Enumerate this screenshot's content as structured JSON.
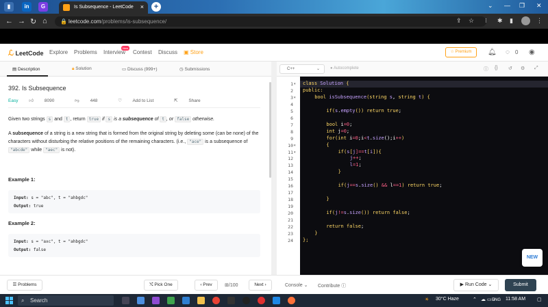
{
  "browser": {
    "tab_title": "Is Subsequence - LeetCode",
    "tab_close": "×",
    "new_tab": "+",
    "url_host": "leetcode.com",
    "url_path": "/problems/is-subsequence/"
  },
  "nav": {
    "logo": "LeetCode",
    "links": [
      "Explore",
      "Problems",
      "Interview",
      "Contest",
      "Discuss",
      "Store"
    ],
    "new_badge": "New",
    "premium": "Premium",
    "coin_count": "0"
  },
  "left_tabs": [
    "Description",
    "Solution",
    "Discuss (999+)",
    "Submissions"
  ],
  "problem": {
    "title": "392. Is Subsequence",
    "difficulty": "Easy",
    "likes": "8090",
    "dislikes": "448",
    "add_to_list": "Add to List",
    "share": "Share",
    "p1_a": "Given two strings",
    "p1_s": "s",
    "p1_and": "and",
    "p1_t": "t",
    "p1_b": ", return",
    "p1_true": "true",
    "p1_if": "if",
    "p1_s2": "s",
    "p1_c": "is a",
    "p1_sub": "subsequence",
    "p1_of": "of",
    "p1_t2": "t",
    "p1_or": ", or",
    "p1_false": "false",
    "p1_end": "otherwise.",
    "p2_a": "A",
    "p2_sub": "subsequence",
    "p2_b": "of a string is a new string that is formed from the original string by deleting some",
    "p2_c": "(can be none) of the characters without disturbing the relative positions of the remaining characters.",
    "p2_d": "(i.e.,",
    "p2_ace": "\"ace\"",
    "p2_e": "is a subsequence of",
    "p2_abcde": "\"abcde\"",
    "p2_f": "while",
    "p2_aec": "\"aec\"",
    "p2_g": "is not).",
    "ex1_title": "Example 1:",
    "ex1_input_label": "Input:",
    "ex1_input": "s = \"abc\", t = \"ahbgdc\"",
    "ex1_output_label": "Output:",
    "ex1_output": "true",
    "ex2_title": "Example 2:",
    "ex2_input_label": "Input:",
    "ex2_input": "s = \"axc\", t = \"ahbgdc\"",
    "ex2_output_label": "Output:",
    "ex2_output": "false"
  },
  "editor": {
    "language": "C++",
    "autocomplete": "Autocomplete",
    "line_numbers": [
      "1",
      "2",
      "3",
      "4",
      "5",
      "6",
      "7",
      "8",
      "9",
      "10",
      "11",
      "12",
      "13",
      "14",
      "15",
      "16",
      "17",
      "18",
      "19",
      "20",
      "21",
      "22",
      "23",
      "24"
    ],
    "new_label": "NEW"
  },
  "bottom": {
    "problems": "Problems",
    "pick_one": "Pick One",
    "prev": "Prev",
    "page": "/100",
    "next": "Next",
    "console": "Console",
    "contribute": "Contribute",
    "run_code": "Run Code",
    "submit": "Submit"
  },
  "taskbar": {
    "search": "Search",
    "weather": "30°C  Haze",
    "lang": "ENG",
    "time": "11:58 AM"
  }
}
